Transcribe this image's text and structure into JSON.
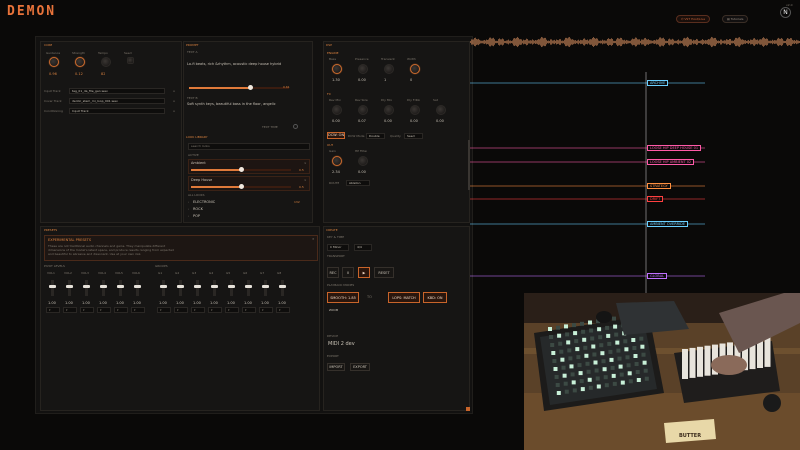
{
  "header": {
    "logo": "DEMON",
    "vst_label": "VST Host/Live",
    "tutorial_label": "Tutorials",
    "corner_label": "v2.0"
  },
  "colors": {
    "accent": "#e07a3a",
    "bg": "#0a0908",
    "marker_blue": "#6ad0ff",
    "marker_pink": "#ff5aa8",
    "marker_orange": "#ff9040",
    "marker_red": "#ff4040",
    "marker_violet": "#c070ff"
  },
  "core": {
    "title": "CORE",
    "knobs": [
      {
        "label": "Guidance",
        "value": "0.96"
      },
      {
        "label": "Strength",
        "value": "0.12"
      },
      {
        "label": "Tempo",
        "value": "82"
      },
      {
        "label": "Seed",
        "value": ""
      }
    ],
    "rows": [
      {
        "label": "Input Track",
        "value": "tag_01_da_file_gen.wav"
      },
      {
        "label": "Cover Track",
        "value": "dentic_stem_mi_loop_001.wav"
      },
      {
        "label": "Conditioning",
        "value": "Input Track"
      }
    ]
  },
  "prompt": {
    "title": "PROMPT",
    "text_a_label": "TEXT A",
    "text_a": "Lo-fi beats, rich &rhythm, acoustic deep house hybrid",
    "text_b_label": "TEXT B",
    "text_b": "Soft synth keys, beautiful bass in the floor, angelic",
    "weight_a": "0.61",
    "weight_b": "0.39",
    "morph_label": "TEXT TIME"
  },
  "look_library": {
    "title": "LOOK LIBRARY",
    "search_placeholder": "search looks",
    "active_label": "ACTIVE",
    "active": [
      {
        "name": "Ambient",
        "value": "0.5"
      },
      {
        "name": "Deep House",
        "value": "0.5"
      }
    ],
    "all_label": "ALL LOOKS",
    "genres": [
      {
        "name": "ELECTRONIC",
        "count": "132"
      },
      {
        "name": "ROCK",
        "count": ""
      },
      {
        "name": "POP",
        "count": ""
      }
    ]
  },
  "dsp": {
    "title": "DSP",
    "engine_label": "ENGINE",
    "engine_knobs": [
      {
        "label": "Bass",
        "value": "1.30"
      },
      {
        "label": "Presence",
        "value": "0.00"
      },
      {
        "label": "Transient",
        "value": "1"
      },
      {
        "label": "Width",
        "value": "0"
      }
    ],
    "fx_label": "FX",
    "fx_knobs": [
      {
        "label": "Rev Mix",
        "value": "0.00"
      },
      {
        "label": "Rev Size",
        "value": "0.07"
      },
      {
        "label": "Dly Mix",
        "value": "0.00"
      },
      {
        "label": "Dly Fdbk",
        "value": "0.00"
      },
      {
        "label": "Sat",
        "value": "0.00"
      }
    ],
    "buttons": [
      {
        "label": "DCW: ON"
      },
      {
        "label": "Double"
      },
      {
        "label": "Seed"
      }
    ],
    "dcw_label": "DCW Mode",
    "quality_label": "Quality",
    "out_label": "OUT",
    "out_knobs": [
      {
        "label": "Gain",
        "value": "2.34"
      },
      {
        "label": "HP Filter",
        "value": "0.00"
      }
    ],
    "route_label": "ROUTE",
    "route_value": "Ableton"
  },
  "presets": {
    "title": "PRESETS",
    "heading": "EXPERIMENTAL PRESETS",
    "desc": "These are not traditional audio channels and gains. They manipulate different dimensions of the model's latent space, and produce results ranging from expected and beautiful to abrasive and dissonant. Use at your own risk."
  },
  "pivot_levels": {
    "title": "PIVOT LEVELS",
    "channels": [
      "VOL1",
      "VOL2",
      "VOL3",
      "VOL4",
      "VOL5",
      "VOL6"
    ],
    "values": [
      "1.00",
      "1.00",
      "1.00",
      "1.00",
      "1.00",
      "1.00"
    ]
  },
  "groups": {
    "title": "GROUPS",
    "channels": [
      "G1",
      "G2",
      "G3",
      "G4",
      "G5",
      "G6",
      "G7",
      "G8"
    ],
    "values": [
      "1.00",
      "1.00",
      "1.00",
      "1.00",
      "1.00",
      "1.00",
      "1.00",
      "1.00"
    ]
  },
  "timeline_markers": [
    {
      "label": "ARCHIVE"
    },
    {
      "label": "LOOSE HIP DEEP HOUSE 01"
    },
    {
      "label": "LOOSE HIP AMBIENT 02"
    },
    {
      "label": "STRATEGY"
    },
    {
      "label": "DRIFT"
    },
    {
      "label": "AMBIENT OVERRIDE"
    },
    {
      "label": "GLOBAL"
    }
  ],
  "transport": {
    "title": "CREATE",
    "key_label": "KEY & TIME",
    "key_value": "C Minor",
    "time_value": "4/4",
    "transport_label": "TRANSPORT",
    "buttons": [
      {
        "label": "REC"
      },
      {
        "label": "II"
      },
      {
        "label": "▶"
      },
      {
        "label": "RESET"
      }
    ],
    "playback_label": "PLAYBACK MODES",
    "modes": [
      {
        "label": "SMOOTH: 1.85"
      },
      {
        "label": "TO"
      },
      {
        "label": "LOPS: MATCH"
      },
      {
        "label": "KBD: ON"
      }
    ],
    "zoom_label": "ZOOM",
    "device_label": "DEVICE",
    "device_value": "MIDI 2 dev",
    "export_label": "EXPORT",
    "actions": [
      {
        "label": "IMPORT"
      },
      {
        "label": "EXPORT"
      }
    ]
  },
  "video": {
    "sticker": "BUTTER"
  }
}
